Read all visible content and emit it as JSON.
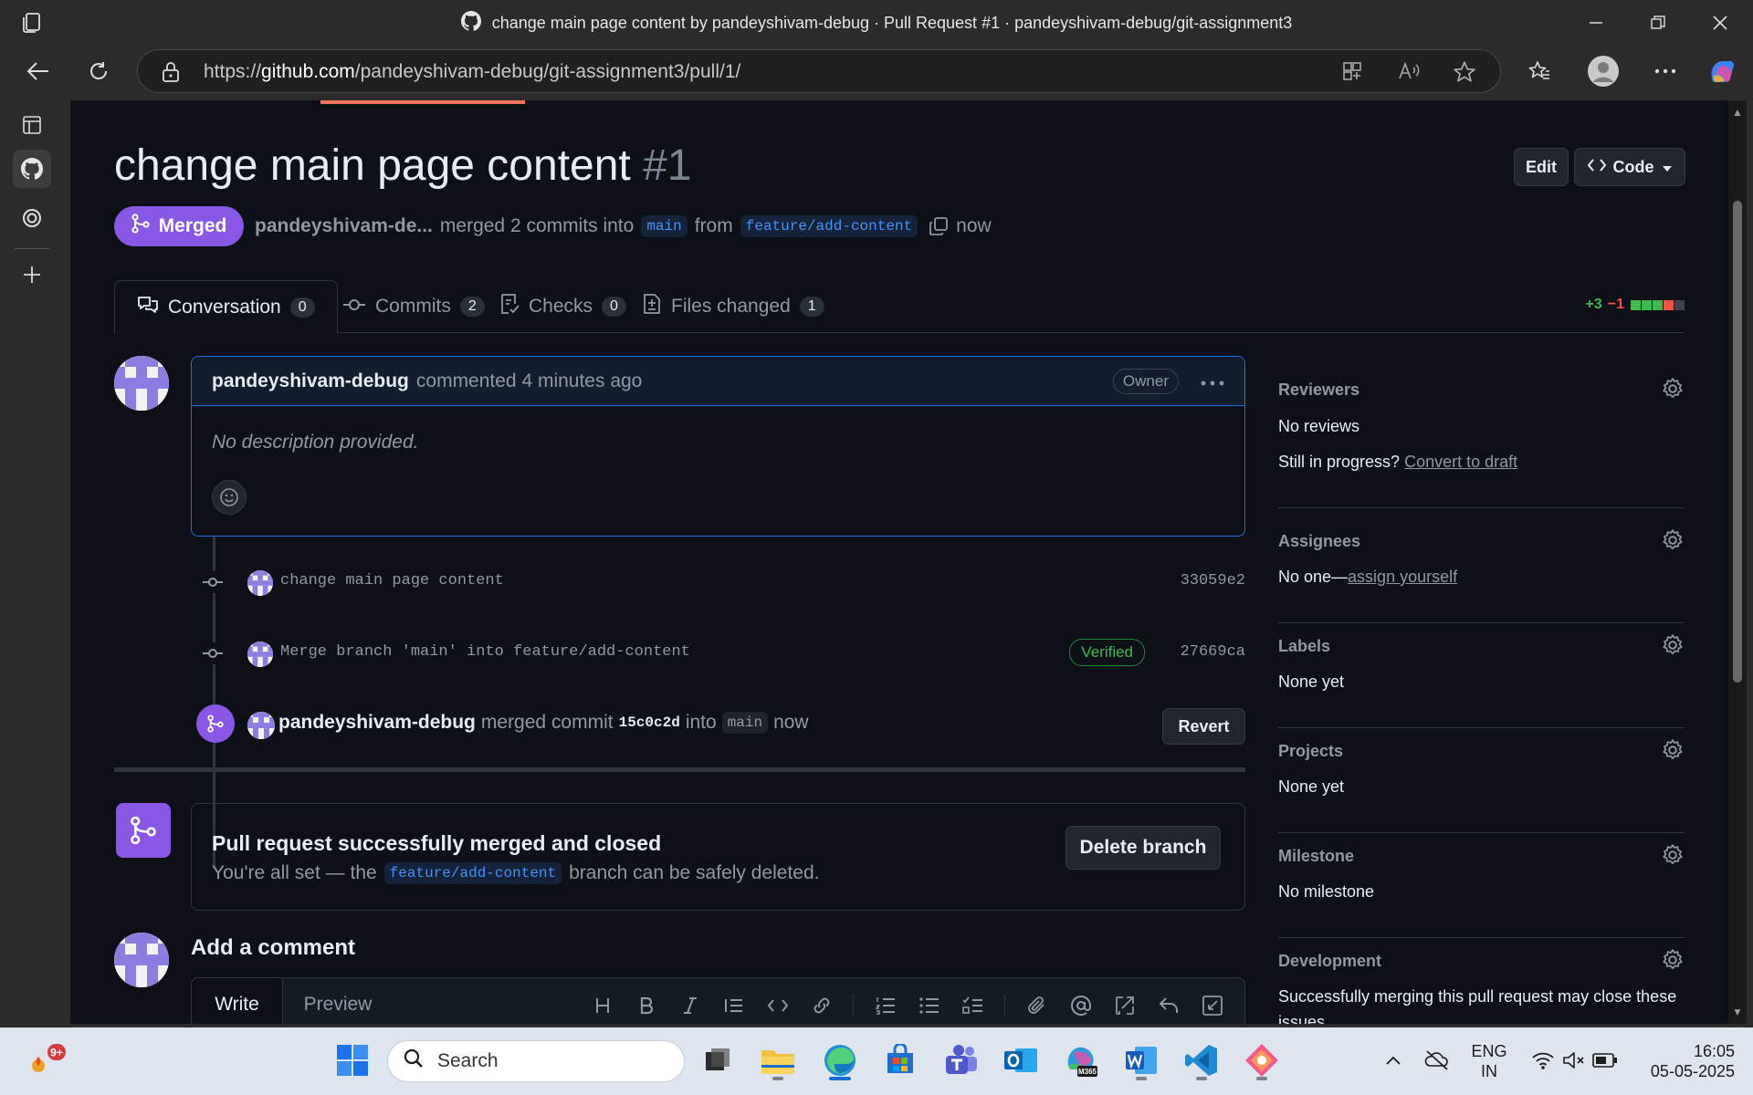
{
  "browser": {
    "window_title": "change main page content by pandeyshivam-debug · Pull Request #1 · pandeyshivam-debug/git-assignment3",
    "url_prefix": "https://",
    "url_domain": "github.com",
    "url_path": "/pandeyshivam-debug/git-assignment3/pull/1/"
  },
  "pr": {
    "title": "change main page content",
    "number": "#1",
    "status": "Merged",
    "author_short": "pandeyshivam-de...",
    "merged_text": "merged 2 commits into",
    "base_branch": "main",
    "from_text": "from",
    "head_branch": "feature/add-content",
    "time": "now",
    "edit_label": "Edit",
    "code_label": "Code"
  },
  "tabs": [
    {
      "label": "Conversation",
      "count": "0"
    },
    {
      "label": "Commits",
      "count": "2"
    },
    {
      "label": "Checks",
      "count": "0"
    },
    {
      "label": "Files changed",
      "count": "1"
    }
  ],
  "diffstat": {
    "additions": "+3",
    "deletions": "−1"
  },
  "comment": {
    "author": "pandeyshivam-debug",
    "when": "commented 4 minutes ago",
    "badge": "Owner",
    "body": "No description provided."
  },
  "commits": [
    {
      "message": "change main page content",
      "sha": "33059e2",
      "verified": ""
    },
    {
      "message": "Merge branch 'main' into feature/add-content",
      "sha": "27669ca",
      "verified": "Verified"
    }
  ],
  "merge_event": {
    "user": "pandeyshivam-debug",
    "text1": "merged commit",
    "sha": "15c0c2d",
    "text2": "into",
    "branch": "main",
    "time": "now",
    "revert_label": "Revert"
  },
  "merged_box": {
    "heading": "Pull request successfully merged and closed",
    "pre": "You're all set — the",
    "branch": "feature/add-content",
    "post": "branch can be safely deleted.",
    "delete_label": "Delete branch"
  },
  "add_comment": {
    "title": "Add a comment",
    "write_tab": "Write",
    "preview_tab": "Preview"
  },
  "sidebar": {
    "reviewers": {
      "label": "Reviewers",
      "value": "No reviews",
      "progress_q": "Still in progress?",
      "progress_link": "Convert to draft"
    },
    "assignees": {
      "label": "Assignees",
      "value": "No one—",
      "link": "assign yourself"
    },
    "labels": {
      "label": "Labels",
      "value": "None yet"
    },
    "projects": {
      "label": "Projects",
      "value": "None yet"
    },
    "milestone": {
      "label": "Milestone",
      "value": "No milestone"
    },
    "development": {
      "label": "Development",
      "value": "Successfully merging this pull request may close these",
      "value2": "issues."
    }
  },
  "taskbar": {
    "search_placeholder": "Search",
    "notif_badge": "9+",
    "lang1": "ENG",
    "lang2": "IN",
    "time": "16:05",
    "date": "05-05-2025",
    "m365_label": "M365"
  }
}
